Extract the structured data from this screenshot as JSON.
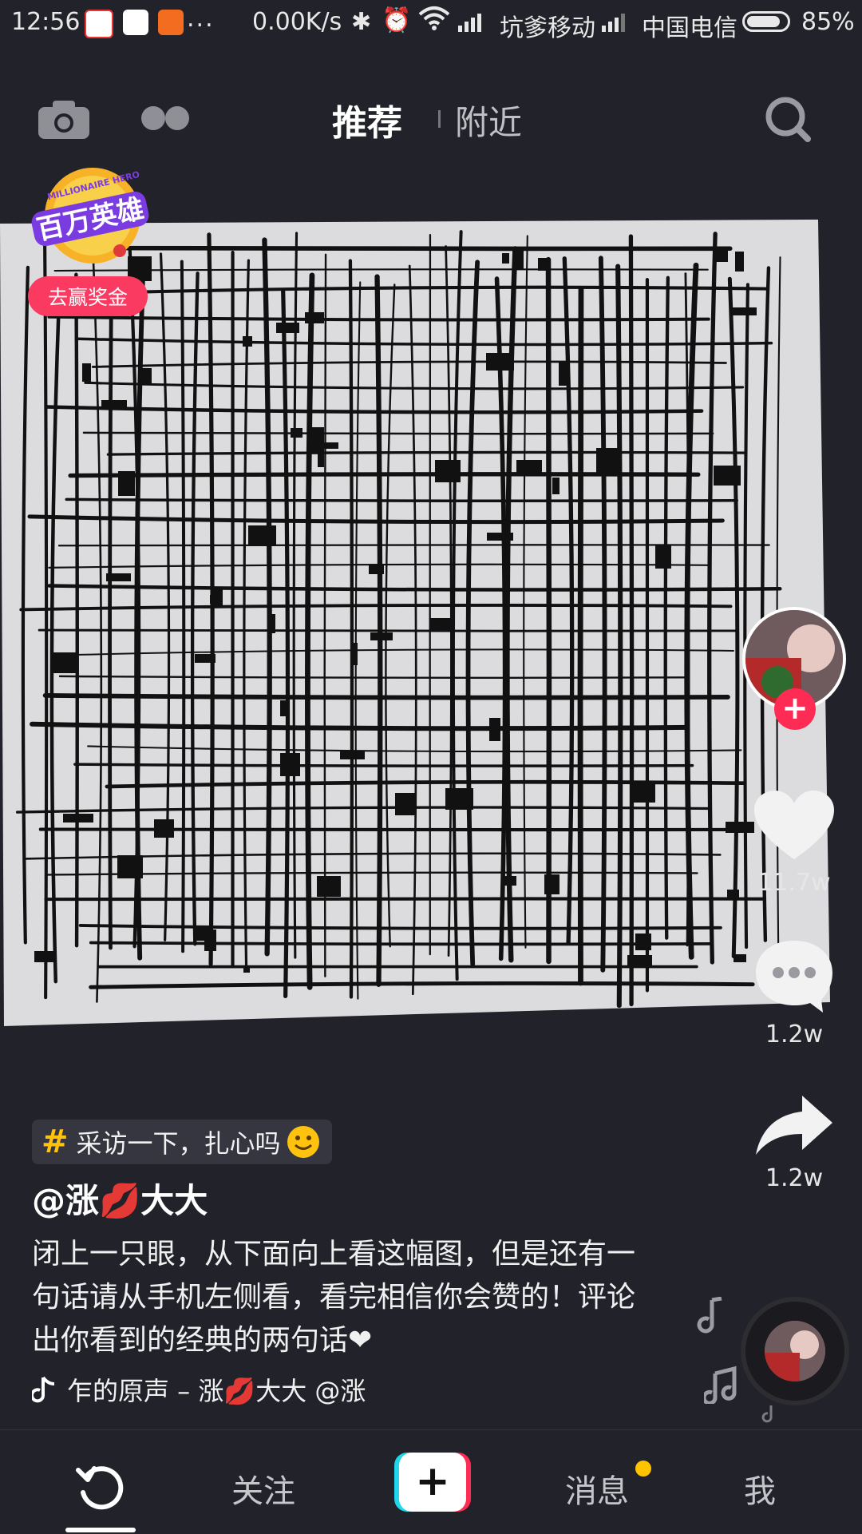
{
  "status_bar": {
    "time": "12:56",
    "more": "...",
    "speed": "0.00K/s",
    "carrier1": "坑爹移动",
    "carrier2": "中国电信",
    "battery_pct": "85%",
    "battery_level": 0.85
  },
  "top_nav": {
    "tab_recommend": "推荐",
    "tab_nearby": "附近"
  },
  "promo": {
    "badge_text": "百万英雄",
    "badge_sub": "MILLIONAIRE HERO",
    "button": "去赢奖金"
  },
  "rail": {
    "like_count": "11.7w",
    "comment_count": "1.2w",
    "share_count": "1.2w"
  },
  "post": {
    "hashtag": "采访一下，扎心吗",
    "author": "@涨💋大大",
    "description": "闭上一只眼，从下面向上看这幅图，但是还有一句话请从手机左侧看，看完相信你会赞的！评论出你看到的经典的两句话❤",
    "music": "乍的原声 – 涨💋大大    @涨"
  },
  "bottom_bar": {
    "follow": "关注",
    "messages": "消息",
    "me": "我"
  },
  "colors": {
    "background": "#22232a",
    "accent_red": "#fe2c55",
    "accent_cyan": "#20d5ec",
    "hashtag_yellow": "#ffc20e"
  }
}
